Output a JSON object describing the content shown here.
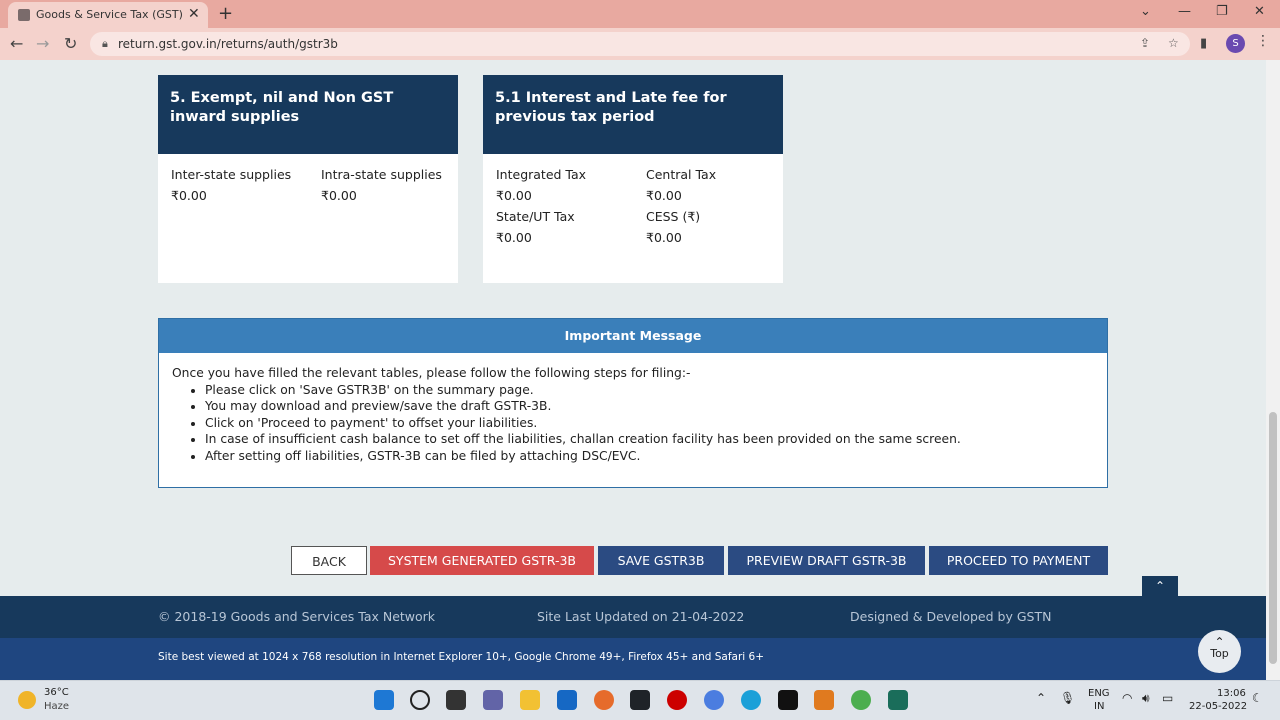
{
  "browser": {
    "tab_title": "Goods & Service Tax (GST) | User",
    "tab_close": "✕",
    "new_tab": "+",
    "url": "return.gst.gov.in/returns/auth/gstr3b",
    "profile_initial": "S"
  },
  "card5": {
    "title": "5. Exempt, nil and Non GST inward supplies",
    "col1_label": "Inter-state supplies",
    "col1_value": "₹0.00",
    "col2_label": "Intra-state supplies",
    "col2_value": "₹0.00"
  },
  "card51": {
    "title": "5.1 Interest and Late fee for previous tax period",
    "integrated_label": "Integrated Tax",
    "integrated_value": "₹0.00",
    "central_label": "Central Tax",
    "central_value": "₹0.00",
    "state_label": "State/UT Tax",
    "state_value": "₹0.00",
    "cess_label": "CESS (₹)",
    "cess_value": "₹0.00"
  },
  "message": {
    "title": "Important Message",
    "intro": "Once you have filled the relevant tables, please follow the following steps for filing:-",
    "steps": [
      "Please click on 'Save GSTR3B' on the summary page.",
      "You may download and preview/save the draft GSTR-3B.",
      "Click on 'Proceed to payment' to offset your liabilities.",
      "In case of insufficient cash balance to set off the liabilities, challan creation facility has been provided on the same screen.",
      "After setting off liabilities, GSTR-3B can be filed by attaching DSC/EVC."
    ]
  },
  "buttons": {
    "back": "BACK",
    "system_generated": "SYSTEM GENERATED GSTR-3B",
    "save": "SAVE GSTR3B",
    "preview": "PREVIEW DRAFT GSTR-3B",
    "proceed": "PROCEED TO PAYMENT"
  },
  "footer": {
    "copyright": "© 2018-19 Goods and Services Tax Network",
    "last_updated": "Site Last Updated on 21-04-2022",
    "designed_by": "Designed & Developed by GSTN",
    "best_viewed": "Site best viewed at 1024 x 768 resolution in Internet Explorer 10+, Google Chrome 49+, Firefox 45+ and Safari 6+",
    "top_label": "Top"
  },
  "taskbar": {
    "temperature": "36°C",
    "weather": "Haze",
    "lang1": "ENG",
    "lang2": "IN",
    "time": "13:06",
    "date": "22-05-2022"
  },
  "colors": {
    "card_header": "#17395c",
    "message_header": "#3a7fba",
    "system_button": "#d64a4a",
    "action_button": "#2b4b82"
  }
}
